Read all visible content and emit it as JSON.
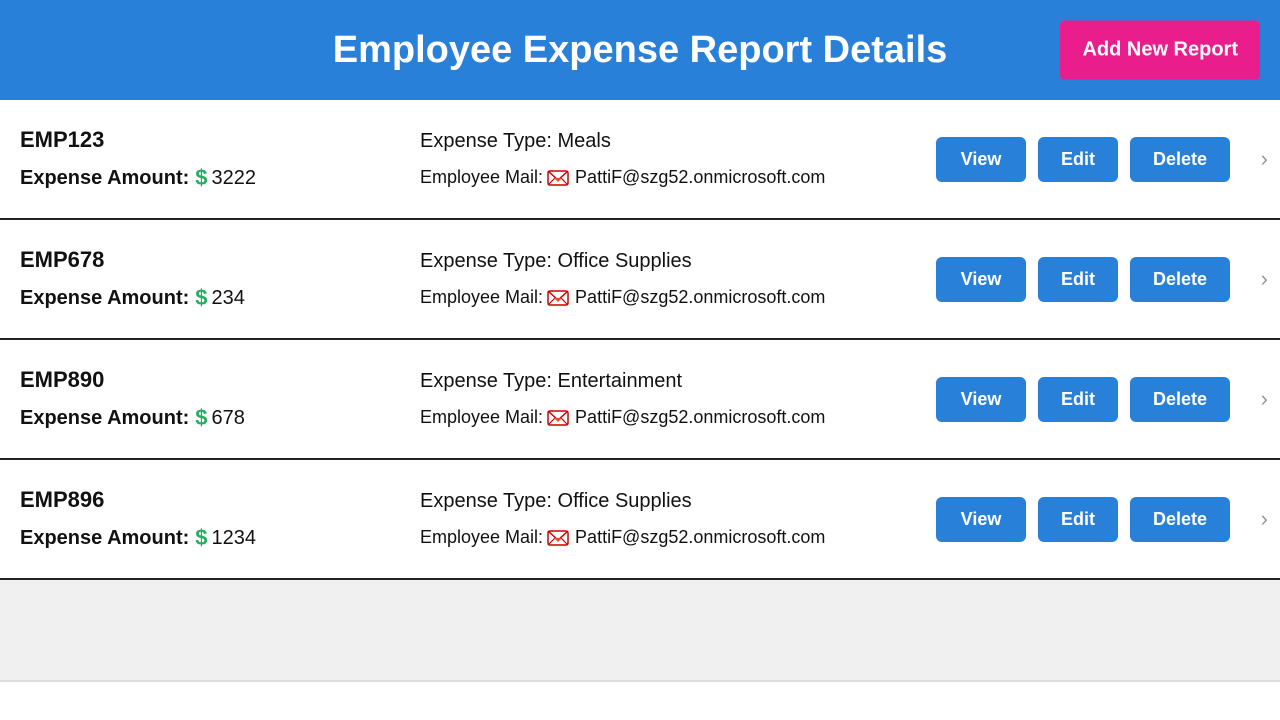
{
  "header": {
    "title": "Employee Expense Report Details",
    "add_button_label": "Add New Report"
  },
  "reports": [
    {
      "id": "EMP123",
      "id_bold": true,
      "expense_amount_label": "Expense Amount:",
      "amount": "3222",
      "expense_type_label": "Expense Type:",
      "expense_type": "Meals",
      "employee_mail_label": "Employee Mail:",
      "employee_mail": "PattiF@szg52.onmicrosoft.com",
      "view_label": "View",
      "edit_label": "Edit",
      "delete_label": "Delete"
    },
    {
      "id": "EMP678",
      "id_bold": false,
      "expense_amount_label": "Expense Amount:",
      "amount": "234",
      "expense_type_label": "Expense Type:",
      "expense_type": "Office Supplies",
      "employee_mail_label": "Employee Mail:",
      "employee_mail": "PattiF@szg52.onmicrosoft.com",
      "view_label": "View",
      "edit_label": "Edit",
      "delete_label": "Delete"
    },
    {
      "id": "EMP890",
      "id_bold": false,
      "expense_amount_label": "Expense Amount:",
      "amount": "678",
      "expense_type_label": "Expense Type:",
      "expense_type": "Entertainment",
      "employee_mail_label": "Employee Mail:",
      "employee_mail": "PattiF@szg52.onmicrosoft.com",
      "view_label": "View",
      "edit_label": "Edit",
      "delete_label": "Delete"
    },
    {
      "id": "EMP896",
      "id_bold": false,
      "expense_amount_label": "Expense Amount:",
      "amount": "1234",
      "expense_type_label": "Expense Type:",
      "expense_type": "Office Supplies",
      "employee_mail_label": "Employee Mail:",
      "employee_mail": "PattiF@szg52.onmicrosoft.com",
      "view_label": "View",
      "edit_label": "Edit",
      "delete_label": "Delete"
    }
  ],
  "icons": {
    "mail": "📧",
    "dollar": "$",
    "chevron": "›"
  }
}
